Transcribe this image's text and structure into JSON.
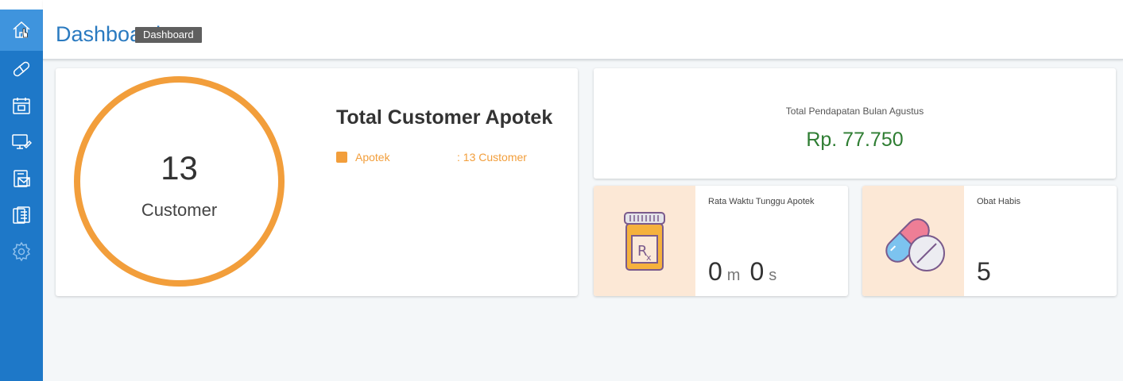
{
  "header": {
    "title": "Dashboard",
    "tooltip": "Dashboard"
  },
  "sidebar": {
    "items": [
      {
        "icon": "home-icon",
        "active": true
      },
      {
        "icon": "pill-icon"
      },
      {
        "icon": "calendar-icon"
      },
      {
        "icon": "monitor-edit-icon"
      },
      {
        "icon": "mail-list-icon"
      },
      {
        "icon": "clipboard-icon"
      },
      {
        "icon": "gear-icon"
      }
    ]
  },
  "customer": {
    "count": "13",
    "unit": "Customer",
    "title": "Total Customer Apotek",
    "legend": {
      "name": "Apotek",
      "value": ": 13 Customer"
    },
    "progress": 1.0
  },
  "income": {
    "label": "Total Pendapatan Bulan Agustus",
    "value": "Rp. 77.750"
  },
  "waiting": {
    "label": "Rata Waktu Tunggu Apotek",
    "minutes": "0",
    "minutes_unit": "m",
    "seconds": "0",
    "seconds_unit": "s"
  },
  "stock": {
    "label": "Obat Habis",
    "value": "5"
  },
  "colors": {
    "sidebar": "#1e78c8",
    "accent": "#f29e3b",
    "income": "#2e7d32",
    "title": "#2a7ac0"
  }
}
